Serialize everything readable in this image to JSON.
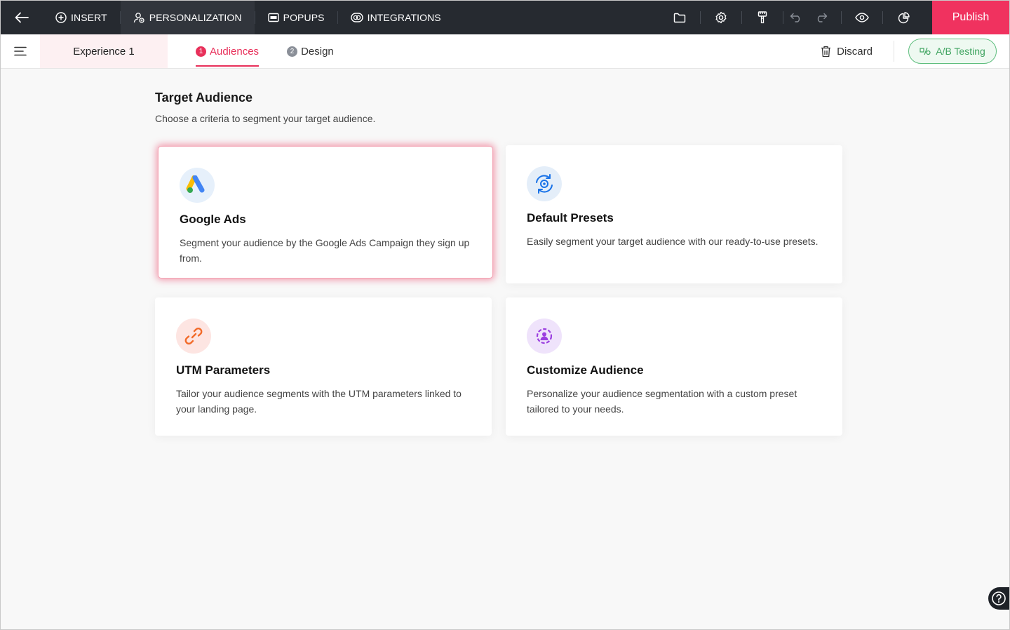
{
  "topbar": {
    "nav": [
      {
        "label": "INSERT",
        "icon": "plus-circle-icon"
      },
      {
        "label": "PERSONALIZATION",
        "icon": "users-icon"
      },
      {
        "label": "POPUPS",
        "icon": "popup-icon"
      },
      {
        "label": "INTEGRATIONS",
        "icon": "integrations-icon"
      }
    ],
    "publish_label": "Publish",
    "accent": "#f0325f"
  },
  "subbar": {
    "experience_name": "Experience 1",
    "steps": [
      {
        "num": "1",
        "label": "Audiences",
        "active": true
      },
      {
        "num": "2",
        "label": "Design",
        "active": false
      }
    ],
    "discard_label": "Discard",
    "abtest_label": "A/B Testing"
  },
  "main": {
    "title": "Target Audience",
    "subtitle": "Choose a criteria to segment your target audience.",
    "cards": [
      {
        "title": "Google Ads",
        "description": "Segment your audience by the Google Ads Campaign they sign up from.",
        "icon": "google-ads-icon",
        "selected": true
      },
      {
        "title": "Default Presets",
        "description": "Easily segment your target audience with our ready-to-use presets.",
        "icon": "presets-icon",
        "selected": false
      },
      {
        "title": "UTM Parameters",
        "description": "Tailor your audience segments with the UTM parameters linked to your landing page.",
        "icon": "link-icon",
        "selected": false
      },
      {
        "title": "Customize Audience",
        "description": "Personalize your audience segmentation with a custom preset tailored to your needs.",
        "icon": "custom-audience-icon",
        "selected": false
      }
    ]
  }
}
